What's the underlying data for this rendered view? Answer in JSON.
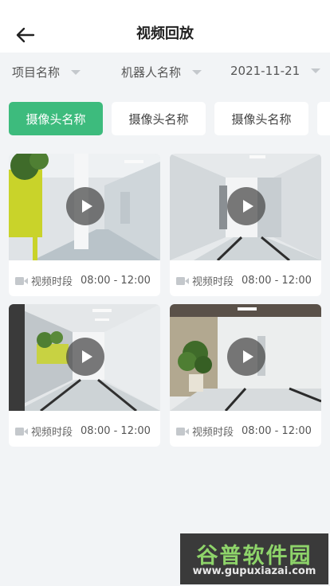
{
  "header": {
    "title": "视频回放",
    "back_icon": "arrow-left-icon"
  },
  "filters": [
    {
      "label": "项目名称"
    },
    {
      "label": "机器人名称"
    },
    {
      "label": "2021-11-21"
    }
  ],
  "cameras": [
    {
      "label": "摄像头名称",
      "active": true
    },
    {
      "label": "摄像头名称",
      "active": false
    },
    {
      "label": "摄像头名称",
      "active": false
    },
    {
      "label": "",
      "active": false
    }
  ],
  "videos": [
    {
      "period_label": "视频时段",
      "time_range": "08:00 - 12:00"
    },
    {
      "period_label": "视频时段",
      "time_range": "08:00 - 12:00"
    },
    {
      "period_label": "视频时段",
      "time_range": "08:00 - 12:00"
    },
    {
      "period_label": "视频时段",
      "time_range": "08:00 - 12:00"
    }
  ],
  "watermark": {
    "logo": "谷普软件园",
    "url": "www.gupuxiazai.com"
  },
  "colors": {
    "accent": "#3dbb7d",
    "background": "#f2f4f6"
  }
}
